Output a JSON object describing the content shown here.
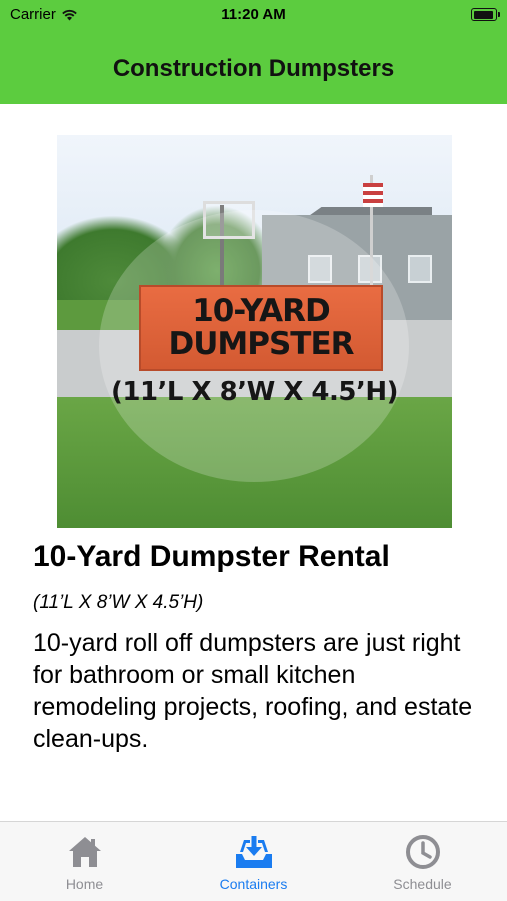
{
  "status_bar": {
    "carrier": "Carrier",
    "time": "11:20 AM",
    "battery_level": 0.95
  },
  "nav": {
    "title": "Construction Dumpsters"
  },
  "hero": {
    "dumpster_line1": "10-YARD",
    "dumpster_line2": "DUMPSTER",
    "dimensions": "(11’L X 8’W X 4.5’H)"
  },
  "content": {
    "title": "10-Yard Dumpster Rental",
    "dimensions": "(11’L X 8’W X 4.5’H)",
    "description": "10-yard roll off dumpsters are just right for bathroom or small kitchen remodeling projects, roofing, and estate clean-ups."
  },
  "tabs": [
    {
      "label": "Home",
      "icon": "home-icon",
      "selected": false
    },
    {
      "label": "Containers",
      "icon": "inbox-download-icon",
      "selected": true
    },
    {
      "label": "Schedule",
      "icon": "clock-icon",
      "selected": false
    }
  ],
  "colors": {
    "brand_green": "#5ccc3f",
    "tab_active": "#1a7cf0",
    "tab_inactive": "#8e8e93"
  }
}
